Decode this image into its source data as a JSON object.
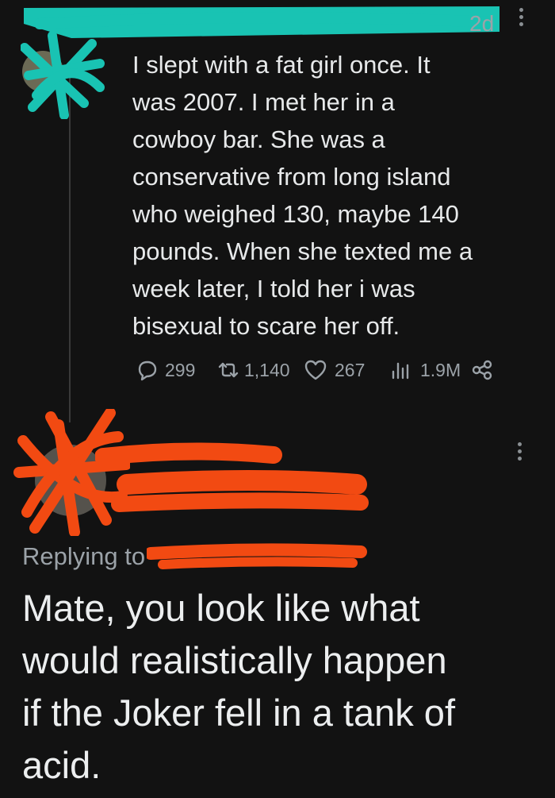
{
  "tweet": {
    "timestamp": "2d",
    "text": "I slept with a fat girl once. It\nwas 2007. I met her in a\ncowboy bar. She was a\nconservative from long island\nwho weighed 130, maybe 140\npounds. When she texted me a\nweek later, I told her i was\nbisexual to scare her off.",
    "stats": {
      "replies": "299",
      "retweets": "1,140",
      "likes": "267",
      "views": "1.9M"
    }
  },
  "reply": {
    "replying_to_label": "Replying to",
    "text": "Mate, you look like what\nwould realistically happen\nif the Joker fell in a tank of\nacid."
  },
  "colors": {
    "background": "#121212",
    "text": "#e7e9ea",
    "muted": "#9ba2a8",
    "redact_teal": "#19c3b3",
    "redact_orange": "#f24a12"
  },
  "icons": [
    "reply-icon",
    "retweet-icon",
    "like-icon",
    "views-icon",
    "share-icon",
    "more-icon"
  ]
}
